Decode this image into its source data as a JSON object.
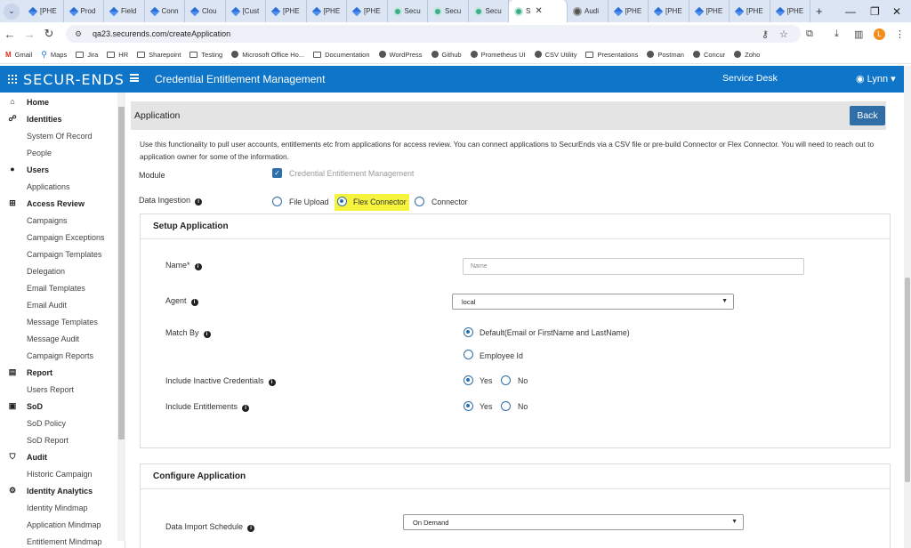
{
  "browser": {
    "tabs": [
      "[PHE",
      "Prod",
      "Field",
      "Conn",
      "Clou",
      "[Cust",
      "[PHE",
      "[PHE",
      "[PHE",
      "Secu",
      "Secu",
      "Secu",
      "S",
      "Audi",
      "[PHE",
      "[PHE",
      "[PHE",
      "[PHE",
      "[PHE"
    ],
    "tab_icons": [
      "jira",
      "jira",
      "jira",
      "jira",
      "jira",
      "jira",
      "jira",
      "jira",
      "jira",
      "sec",
      "sec",
      "sec",
      "sec",
      "audit",
      "jira",
      "jira",
      "jira",
      "jira",
      "jira"
    ],
    "active_tab_index": 12,
    "new_tab": "+",
    "url": "qa23.securends.com/createApplication",
    "profile_initial": "L",
    "bookmarks": [
      "Gmail",
      "Maps",
      "Jira",
      "HR",
      "Sharepoint",
      "Testing",
      "Microsoft Office Ho...",
      "Documentation",
      "WordPress",
      "Github",
      "Prometheus UI",
      "CSV Utility",
      "Presentations",
      "Postman",
      "Concur",
      "Zoho"
    ],
    "bookmark_icons": [
      "gmail",
      "maps",
      "folder",
      "folder",
      "folder",
      "folder",
      "dot",
      "folder",
      "dot",
      "dot",
      "dot",
      "dot",
      "folder",
      "dot",
      "dot",
      "dot"
    ]
  },
  "app": {
    "logo": "SECUR-ENDS",
    "title": "Credential Entitlement Management",
    "service_desk": "Service Desk",
    "user": "Lynn"
  },
  "sidebar": [
    {
      "label": "Home",
      "type": "section",
      "icon": "home-icon"
    },
    {
      "label": "Identities",
      "type": "section",
      "icon": "identities-icon"
    },
    {
      "label": "System Of Record",
      "type": "sub"
    },
    {
      "label": "People",
      "type": "sub"
    },
    {
      "label": "Users",
      "type": "section",
      "icon": "user-icon"
    },
    {
      "label": "Applications",
      "type": "sub"
    },
    {
      "label": "Access Review",
      "type": "section",
      "icon": "grid-icon"
    },
    {
      "label": "Campaigns",
      "type": "sub"
    },
    {
      "label": "Campaign Exceptions",
      "type": "sub"
    },
    {
      "label": "Campaign Templates",
      "type": "sub"
    },
    {
      "label": "Delegation",
      "type": "sub"
    },
    {
      "label": "Email Templates",
      "type": "sub"
    },
    {
      "label": "Email Audit",
      "type": "sub"
    },
    {
      "label": "Message Templates",
      "type": "sub"
    },
    {
      "label": "Message Audit",
      "type": "sub"
    },
    {
      "label": "Campaign Reports",
      "type": "sub"
    },
    {
      "label": "Report",
      "type": "section",
      "icon": "report-icon"
    },
    {
      "label": "Users Report",
      "type": "sub"
    },
    {
      "label": "SoD",
      "type": "section",
      "icon": "sod-icon"
    },
    {
      "label": "SoD Policy",
      "type": "sub"
    },
    {
      "label": "SoD Report",
      "type": "sub"
    },
    {
      "label": "Audit",
      "type": "section",
      "icon": "shield-icon"
    },
    {
      "label": "Historic Campaign",
      "type": "sub"
    },
    {
      "label": "Identity Analytics",
      "type": "section",
      "icon": "analytics-icon"
    },
    {
      "label": "Identity Mindmap",
      "type": "sub"
    },
    {
      "label": "Application Mindmap",
      "type": "sub"
    },
    {
      "label": "Entitlement Mindmap",
      "type": "sub"
    }
  ],
  "page": {
    "heading": "Application",
    "back_label": "Back",
    "description": "Use this functionality to pull user accounts, entitlements etc from applications for access review. You can connect applications to SecurEnds via a CSV file or pre-build Connector or Flex Connector. You will need to reach out to application owner for some of the information.",
    "module_label": "Module",
    "module_value": "Credential Entitlement Management",
    "ingestion_label": "Data Ingestion",
    "ingestion_options": [
      "File Upload",
      "Flex Connector",
      "Connector"
    ],
    "ingestion_selected": "Flex Connector"
  },
  "setup": {
    "title": "Setup Application",
    "name_label": "Name*",
    "name_placeholder": "Name",
    "agent_label": "Agent",
    "agent_value": "local",
    "match_label": "Match By",
    "match_options": [
      "Default(Email or FirstName and LastName)",
      "Employee Id"
    ],
    "match_selected": "Default(Email or FirstName and LastName)",
    "inactive_label": "Include Inactive Credentials",
    "inactive_options": [
      "Yes",
      "No"
    ],
    "inactive_selected": "Yes",
    "entitlements_label": "Include Entitlements",
    "entitlements_options": [
      "Yes",
      "No"
    ],
    "entitlements_selected": "Yes"
  },
  "configure": {
    "title": "Configure Application",
    "schedule_label": "Data Import Schedule",
    "schedule_value": "On Demand"
  }
}
